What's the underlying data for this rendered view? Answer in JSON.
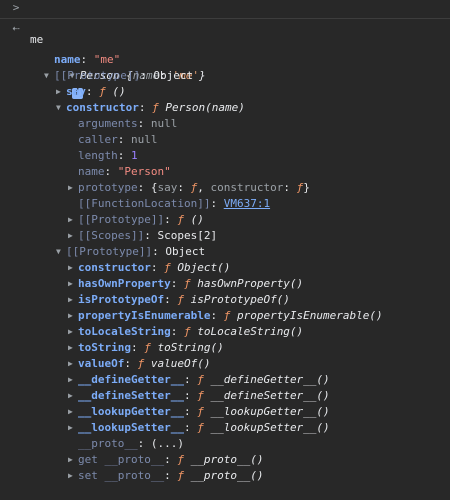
{
  "input": {
    "prompt_icon": "chevron-right-icon",
    "text": "me"
  },
  "result": {
    "return_icon": "return-arrow-icon",
    "class_name": "Person",
    "preview_open": "{",
    "preview_key": "name",
    "preview_sep": ": ",
    "preview_value": "'me'",
    "preview_close": "}",
    "info_badge": "i"
  },
  "rows": {
    "name_key": "name",
    "name_val": "\"me\"",
    "proto1_key": "[[Prototype]]",
    "proto1_val": "Object",
    "say_key": "say",
    "say_f": "ƒ",
    "say_sig": "()",
    "ctor_key": "constructor",
    "ctor_f": "ƒ",
    "ctor_sig": "Person(name)",
    "args_key": "arguments",
    "args_val": "null",
    "caller_key": "caller",
    "caller_val": "null",
    "len_key": "length",
    "len_val": "1",
    "fname_key": "name",
    "fname_val": "\"Person\"",
    "prototype_key": "prototype",
    "prototype_open": "{",
    "prototype_k1": "say",
    "prototype_v1": "ƒ",
    "prototype_mid": ", ",
    "prototype_k2": "constructor",
    "prototype_v2": "ƒ",
    "prototype_close": "}",
    "floc_key": "[[FunctionLocation]]",
    "floc_val": "VM637:1",
    "fproto_key": "[[Prototype]]",
    "fproto_f": "ƒ",
    "fproto_sig": "()",
    "scopes_key": "[[Scopes]]",
    "scopes_val": "Scopes[2]",
    "proto2_key": "[[Prototype]]",
    "proto2_val": "Object",
    "oc_key": "constructor",
    "oc_f": "ƒ",
    "oc_sig": "Object()",
    "hop_key": "hasOwnProperty",
    "hop_f": "ƒ",
    "hop_sig": "hasOwnProperty()",
    "ipo_key": "isPrototypeOf",
    "ipo_f": "ƒ",
    "ipo_sig": "isPrototypeOf()",
    "pie_key": "propertyIsEnumerable",
    "pie_f": "ƒ",
    "pie_sig": "propertyIsEnumerable()",
    "tls_key": "toLocaleString",
    "tls_f": "ƒ",
    "tls_sig": "toLocaleString()",
    "ts_key": "toString",
    "ts_f": "ƒ",
    "ts_sig": "toString()",
    "vo_key": "valueOf",
    "vo_f": "ƒ",
    "vo_sig": "valueOf()",
    "dg_key": "__defineGetter__",
    "dg_f": "ƒ",
    "dg_sig": "__defineGetter__()",
    "ds_key": "__defineSetter__",
    "ds_f": "ƒ",
    "ds_sig": "__defineSetter__()",
    "lg_key": "__lookupGetter__",
    "lg_f": "ƒ",
    "lg_sig": "__lookupGetter__()",
    "ls_key": "__lookupSetter__",
    "ls_f": "ƒ",
    "ls_sig": "__lookupSetter__()",
    "pr_key": "__proto__",
    "pr_val": "(...)",
    "gp_key": "get __proto__",
    "gp_f": "ƒ",
    "gp_sig": "__proto__()",
    "sp_key": "set __proto__",
    "sp_f": "ƒ",
    "sp_sig": "__proto__()"
  },
  "colon": ": "
}
